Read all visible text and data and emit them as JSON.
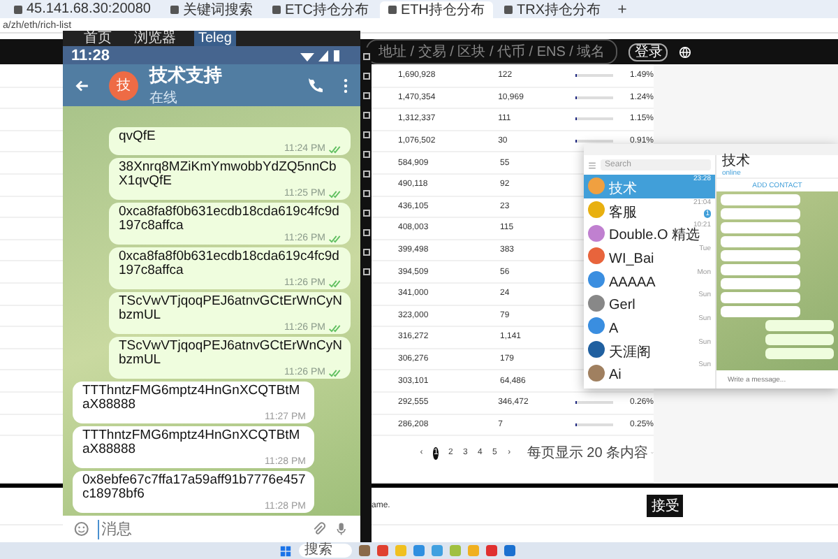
{
  "browser": {
    "tabs": [
      {
        "title": "45.141.68.30:20080",
        "selected": false
      },
      {
        "title": "关键词搜索",
        "selected": false
      },
      {
        "title": "ETC持仓分布",
        "selected": false
      },
      {
        "title": "ETH持仓分布",
        "selected": true
      },
      {
        "title": "TRX持仓分布",
        "selected": false
      }
    ],
    "address": "a/zh/eth/rich-list"
  },
  "page": {
    "search_placeholder": "地址 / 交易 / 区块 / 代币 / ENS / 域名",
    "login": "登录",
    "rows": [
      {
        "balance": "1,690,928",
        "count": "122",
        "level": 0.06,
        "share": "1.49%"
      },
      {
        "balance": "1,470,354",
        "count": "10,969",
        "level": 0.05,
        "share": "1.24%"
      },
      {
        "balance": "1,312,337",
        "count": "111",
        "level": 0.05,
        "share": "1.15%"
      },
      {
        "balance": "1,076,502",
        "count": "30",
        "level": 0.04,
        "share": "0.91%"
      },
      {
        "balance": "584,909",
        "count": "55"
      },
      {
        "balance": "490,118",
        "count": "92"
      },
      {
        "balance": "436,105",
        "count": "23"
      },
      {
        "balance": "408,003",
        "count": "115"
      },
      {
        "balance": "399,498",
        "count": "383"
      },
      {
        "balance": "394,509",
        "count": "56"
      },
      {
        "balance": "341,000",
        "count": "24"
      },
      {
        "balance": "323,000",
        "count": "79"
      },
      {
        "balance": "316,272",
        "count": "1,141"
      },
      {
        "balance": "306,276",
        "count": "179"
      },
      {
        "balance": "303,101",
        "count": "64,486"
      },
      {
        "balance": "292,555",
        "count": "346,472",
        "level": 0.01,
        "share": "0.26%"
      },
      {
        "balance": "286,208",
        "count": "7",
        "level": 0.01,
        "share": "0.25%"
      }
    ],
    "pagination": {
      "prev": "‹",
      "next": "›",
      "pages": [
        {
          "label": "1",
          "selected": true
        },
        {
          "label": "2",
          "selected": false
        },
        {
          "label": "3",
          "selected": false
        },
        {
          "label": "4",
          "selected": false
        },
        {
          "label": "5",
          "selected": false
        }
      ],
      "page_size": "每页显示 20 条内容"
    },
    "cookie": {
      "text": "ame.",
      "button": "接受"
    }
  },
  "phone": {
    "tabs": [
      {
        "label": "首页",
        "selected": false
      },
      {
        "label": "浏览器",
        "selected": false
      },
      {
        "label": "Teleg",
        "selected": true
      }
    ],
    "time": "11:28",
    "avatar": "技",
    "title": "技术支持",
    "status": "在线",
    "messages": [
      {
        "out": true,
        "text": "qvQfE",
        "time": "11:24 PM"
      },
      {
        "out": true,
        "text": "38Xnrq8MZiKmYmwobbYdZQ5nnCbX1qvQfE",
        "time": "11:25 PM"
      },
      {
        "out": true,
        "text": "0xca8fa8f0b631ecdb18cda619c4fc9d197c8affca",
        "time": "11:26 PM"
      },
      {
        "out": true,
        "text": "0xca8fa8f0b631ecdb18cda619c4fc9d197c8affca",
        "time": "11:26 PM"
      },
      {
        "out": true,
        "text": "TScVwVTjqoqPEJ6atnvGCtErWnCyNbzmUL",
        "time": "11:26 PM"
      },
      {
        "out": true,
        "text": "TScVwVTjqoqPEJ6atnvGCtErWnCyNbzmUL",
        "time": "11:26 PM"
      },
      {
        "out": false,
        "text": "TTThntzFMG6mptz4HnGnXCQTBtMaX88888",
        "time": "11:27 PM"
      },
      {
        "out": false,
        "text": "TTThntzFMG6mptz4HnGnXCQTBtMaX88888",
        "time": "11:28 PM"
      },
      {
        "out": false,
        "text": "0x8ebfe67c7ffa17a59aff91b7776e457c18978bf6",
        "time": "11:28 PM"
      }
    ],
    "placeholder": "消息"
  },
  "desktop_telegram": {
    "search_placeholder": "Search",
    "chats": [
      {
        "name": "技术",
        "time": "23:28",
        "selected": true,
        "color": "#f0a040"
      },
      {
        "name": "客服",
        "time": "21:04",
        "selected": false,
        "color": "#e8b010",
        "badge": "1"
      },
      {
        "name": "Double.O 精选",
        "time": "10:21",
        "selected": false,
        "color": "#c080d0"
      },
      {
        "name": "WI_Bai",
        "time": "Tue",
        "selected": false,
        "color": "#e8643c"
      },
      {
        "name": "AAAAA",
        "time": "Mon",
        "selected": false,
        "color": "#3a8ee0"
      },
      {
        "name": "Gerl",
        "time": "Sun",
        "selected": false,
        "color": "#888888"
      },
      {
        "name": "A",
        "time": "Sun",
        "selected": false,
        "color": "#3a8ee0"
      },
      {
        "name": "天涯阁",
        "time": "Sun",
        "selected": false,
        "color": "#2060a0"
      },
      {
        "name": "Ai",
        "time": "Sun",
        "selected": false,
        "color": "#a08060"
      }
    ],
    "title": "技术",
    "status": "online",
    "add_contact": "ADD CONTACT",
    "messages": [
      {
        "kind": "in"
      },
      {
        "kind": "in"
      },
      {
        "kind": "in"
      },
      {
        "kind": "in"
      },
      {
        "kind": "in"
      },
      {
        "kind": "in"
      },
      {
        "kind": "in"
      },
      {
        "kind": "in"
      },
      {
        "kind": "in"
      },
      {
        "kind": "out"
      },
      {
        "kind": "out"
      },
      {
        "kind": "out"
      }
    ],
    "placeholder": "Write a message..."
  },
  "taskbar": {
    "search": "搜索"
  }
}
